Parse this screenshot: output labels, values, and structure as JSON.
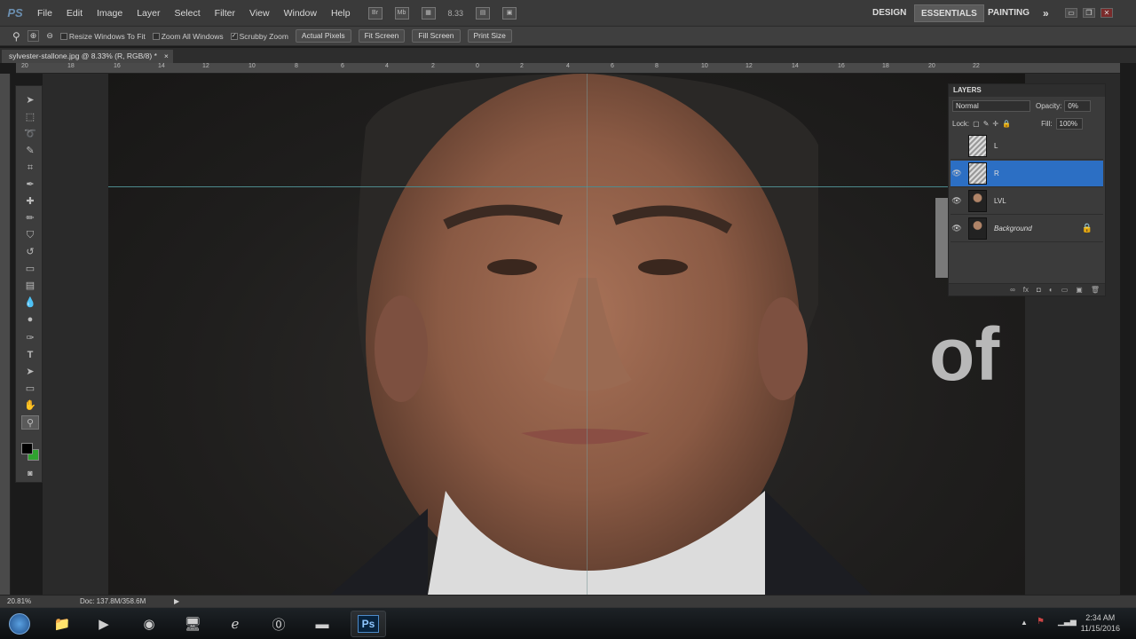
{
  "app": {
    "logo": "PS"
  },
  "menu": [
    "File",
    "Edit",
    "Image",
    "Layer",
    "Select",
    "Filter",
    "View",
    "Window",
    "Help"
  ],
  "menubar_icons": [
    "Br",
    "Mb"
  ],
  "zoom_field": "8.33",
  "workspaces": {
    "design": "DESIGN",
    "essentials": "ESSENTIALS",
    "painting": "PAINTING",
    "more": "»"
  },
  "window_controls": {
    "minimize": "▭",
    "restore": "❐",
    "close": "✕"
  },
  "options": {
    "resize_windows": "Resize Windows To Fit",
    "zoom_all": "Zoom All Windows",
    "scrubby": "Scrubby Zoom",
    "actual_pixels": "Actual Pixels",
    "fit_screen": "Fit Screen",
    "fill_screen": "Fill Screen",
    "print_size": "Print Size"
  },
  "document_tab": {
    "title": "sylvester-stallone.jpg @ 8.33% (R, RGB/8) *",
    "close": "×"
  },
  "ruler_top_labels": [
    "20",
    "18",
    "16",
    "14",
    "12",
    "10",
    "8",
    "6",
    "4",
    "2",
    "0",
    "2",
    "4",
    "6",
    "8",
    "10",
    "12",
    "14",
    "16",
    "18",
    "20",
    "22"
  ],
  "canvas_text": {
    "of": "of"
  },
  "status": {
    "zoom": "20.81%",
    "doc": "Doc: 137.8M/358.6M"
  },
  "layers_panel": {
    "title": "LAYERS",
    "blend_mode": "Normal",
    "opacity_label": "Opacity:",
    "opacity_value": "0%",
    "lock_label": "Lock:",
    "fill_label": "Fill:",
    "fill_value": "100%",
    "layers": [
      {
        "name": "L",
        "visible": false,
        "active": false
      },
      {
        "name": "R",
        "visible": true,
        "active": true
      },
      {
        "name": "LVL",
        "visible": true,
        "active": false
      },
      {
        "name": "Background",
        "visible": true,
        "active": false,
        "locked": true
      }
    ]
  },
  "taskbar": {
    "time": "2:34 AM",
    "date": "11/15/2016",
    "ps_label": "Ps"
  },
  "colors": {
    "accent": "#2c6fc4",
    "foreground": "#000000",
    "background": "#2fa32f"
  }
}
